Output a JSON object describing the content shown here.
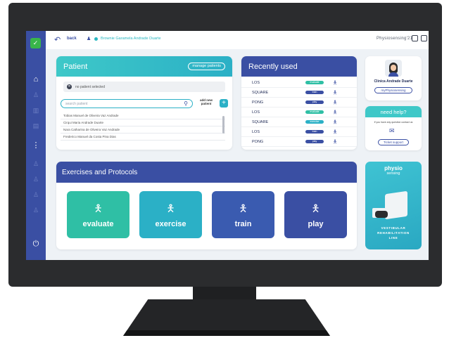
{
  "topbar": {
    "back_label": "back",
    "user_name": "Brownie Garamela Andrade Duarte",
    "brand": "Physiosensing'21",
    "icons": [
      "arrow-left-icon",
      "user-icon",
      "monitor-icon",
      "tablet-icon"
    ]
  },
  "sidebar": {
    "icons": [
      "home-icon",
      "user-icon",
      "chart-icon",
      "book-icon",
      "menu-dots-icon",
      "person-icon",
      "person-icon",
      "person-icon",
      "person-icon",
      "power-icon"
    ]
  },
  "patient": {
    "title": "Patient",
    "manage_label": "manage patients",
    "no_selection": "no patient selected",
    "search_placeholder": "search patient",
    "add_label": "add new patient",
    "patients": [
      "Tobias Manuel de Oliveira Vaz Andrade",
      "Cirqui Maria Andrade Duarte",
      "Nara Catharina de Oliveira Vaz Andrade",
      "Frederico Manuel da Costa Pina Dias"
    ]
  },
  "recent": {
    "title": "Recently used",
    "items": [
      {
        "name": "LOS",
        "tag": "evaluate",
        "color": "#2fbfa5"
      },
      {
        "name": "SQUARE",
        "tag": "train",
        "color": "#3a4fa3"
      },
      {
        "name": "PONG",
        "tag": "play",
        "color": "#3a4fa3"
      },
      {
        "name": "LOS",
        "tag": "evaluate",
        "color": "#2fbfa5"
      },
      {
        "name": "SQUARE",
        "tag": "exercise",
        "color": "#2bb0c6"
      },
      {
        "name": "LOS",
        "tag": "train",
        "color": "#3a4fa3"
      },
      {
        "name": "PONG",
        "tag": "play",
        "color": "#3a4fa3"
      }
    ]
  },
  "profile": {
    "name": "Clinica Andrade Duarte",
    "button": "myPhysiosensing"
  },
  "help": {
    "title": "need help?",
    "text": "If you have any question contact us",
    "button": "Ticket support"
  },
  "exercises": {
    "title": "Exercises and Protocols",
    "tiles": [
      {
        "label": "evaluate",
        "color": "#2fbfa5"
      },
      {
        "label": "exercise",
        "color": "#2bb0c6"
      },
      {
        "label": "train",
        "color": "#3a5bb0"
      },
      {
        "label": "play",
        "color": "#3a4fa3"
      }
    ]
  },
  "promo": {
    "brand_top": "physio",
    "brand_bottom": "sensing",
    "line1": "VESTIBULAR",
    "line2": "REHABILITATION",
    "line3": "LINE"
  }
}
